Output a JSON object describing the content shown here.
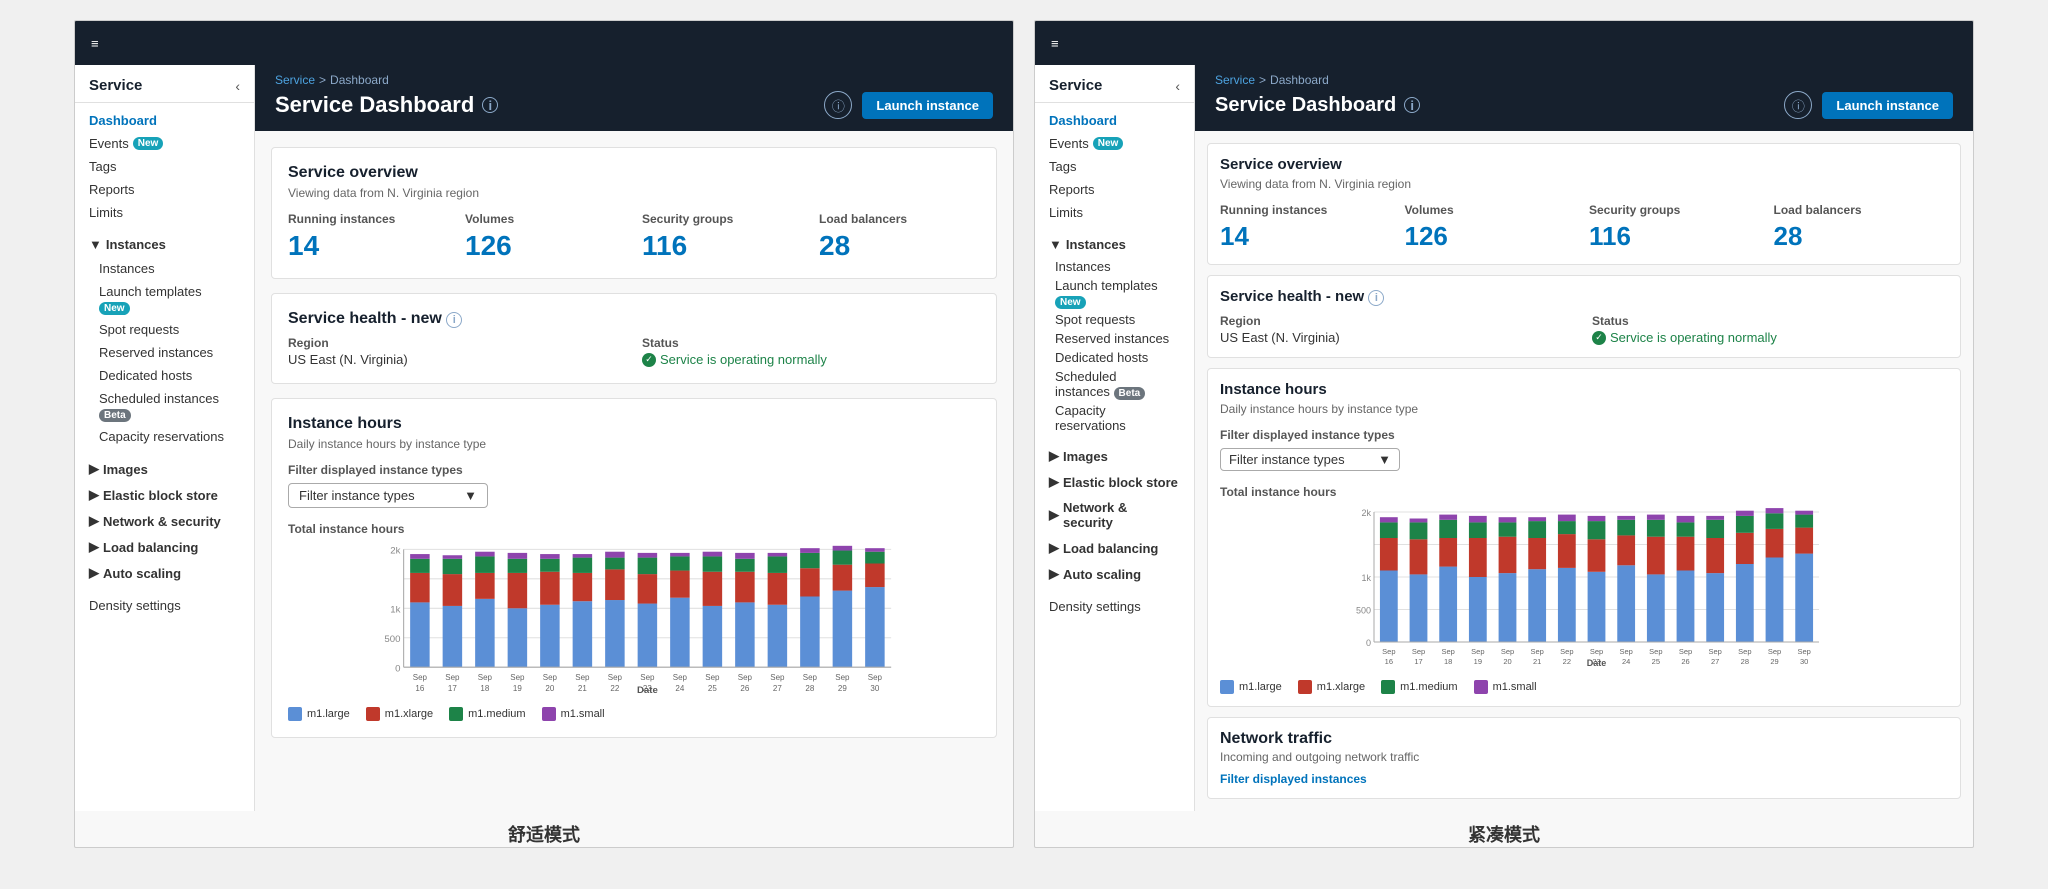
{
  "panels": [
    {
      "id": "comfortable",
      "mode_label": "舒适模式",
      "sidebar": {
        "title": "Service",
        "nav_items": [
          {
            "label": "Dashboard",
            "type": "link",
            "active": true
          },
          {
            "label": "Events",
            "type": "link",
            "badge": "New",
            "badge_type": "new"
          },
          {
            "label": "Tags",
            "type": "link"
          },
          {
            "label": "Reports",
            "type": "link"
          },
          {
            "label": "Limits",
            "type": "link"
          },
          {
            "label": "Instances",
            "type": "section",
            "expanded": true,
            "children": [
              {
                "label": "Instances"
              },
              {
                "label": "Launch templates",
                "badge": "New",
                "badge_type": "new"
              },
              {
                "label": "Spot requests"
              },
              {
                "label": "Reserved instances"
              },
              {
                "label": "Dedicated hosts"
              },
              {
                "label": "Scheduled instances",
                "badge": "Beta",
                "badge_type": "beta"
              },
              {
                "label": "Capacity reservations"
              }
            ]
          },
          {
            "label": "Images",
            "type": "section",
            "expanded": false
          },
          {
            "label": "Elastic block store",
            "type": "section",
            "expanded": false
          },
          {
            "label": "Network & security",
            "type": "section",
            "expanded": false
          },
          {
            "label": "Load balancing",
            "type": "section",
            "expanded": false
          },
          {
            "label": "Auto scaling",
            "type": "section",
            "expanded": false
          },
          {
            "label": "Density settings",
            "type": "link",
            "bottom": true
          }
        ]
      },
      "header": {
        "breadcrumb_service": "Service",
        "breadcrumb_sep": ">",
        "breadcrumb_page": "Dashboard",
        "title": "Service Dashboard",
        "title_suffix": "info",
        "launch_btn": "Launch instance"
      },
      "overview": {
        "title": "Service overview",
        "subtitle": "Viewing data from N. Virginia region",
        "stats": [
          {
            "label": "Running instances",
            "value": "14"
          },
          {
            "label": "Volumes",
            "value": "126"
          },
          {
            "label": "Security groups",
            "value": "116"
          },
          {
            "label": "Load balancers",
            "value": "28"
          }
        ]
      },
      "health": {
        "title": "Service health - new",
        "title_badge": "Info",
        "region_label": "Region",
        "region_value": "US East (N. Virginia)",
        "status_label": "Status",
        "status_value": "Service is operating normally"
      },
      "instance_hours": {
        "title": "Instance hours",
        "subtitle": "Daily instance hours by instance type",
        "filter_label": "Filter displayed instance types",
        "filter_placeholder": "Filter instance types",
        "chart_title": "Total instance hours",
        "y_labels": [
          "2k",
          "1k",
          "500",
          "0"
        ],
        "x_labels": [
          "Sep 16",
          "Sep 17",
          "Sep 18",
          "Sep 19",
          "Sep 20",
          "Sep 21",
          "Sep 22",
          "Sep 23",
          "Sep 24",
          "Sep 25",
          "Sep 26",
          "Sep 27",
          "Sep 28",
          "Sep 29",
          "Sep 30"
        ],
        "x_axis_title": "Date",
        "legend": [
          {
            "label": "m1.large",
            "color": "#5b8fd6"
          },
          {
            "label": "m1.xlarge",
            "color": "#c0392b"
          },
          {
            "label": "m1.medium",
            "color": "#1d8348"
          },
          {
            "label": "m1.small",
            "color": "#8e44ad"
          }
        ]
      }
    },
    {
      "id": "compact",
      "mode_label": "紧凑模式",
      "sidebar": {
        "title": "Service",
        "nav_items": [
          {
            "label": "Dashboard",
            "type": "link",
            "active": true
          },
          {
            "label": "Events",
            "type": "link",
            "badge": "New",
            "badge_type": "new"
          },
          {
            "label": "Tags",
            "type": "link"
          },
          {
            "label": "Reports",
            "type": "link"
          },
          {
            "label": "Limits",
            "type": "link"
          },
          {
            "label": "Instances",
            "type": "section",
            "expanded": true,
            "children": [
              {
                "label": "Instances"
              },
              {
                "label": "Launch templates",
                "badge": "New",
                "badge_type": "new"
              },
              {
                "label": "Spot requests"
              },
              {
                "label": "Reserved instances"
              },
              {
                "label": "Dedicated hosts"
              },
              {
                "label": "Scheduled instances",
                "badge": "Beta",
                "badge_type": "beta"
              },
              {
                "label": "Capacity reservations"
              }
            ]
          },
          {
            "label": "Images",
            "type": "section",
            "expanded": false
          },
          {
            "label": "Elastic block store",
            "type": "section",
            "expanded": false
          },
          {
            "label": "Network & security",
            "type": "section",
            "expanded": false
          },
          {
            "label": "Load balancing",
            "type": "section",
            "expanded": false
          },
          {
            "label": "Auto scaling",
            "type": "section",
            "expanded": false
          },
          {
            "label": "Density settings",
            "type": "link",
            "bottom": true
          }
        ]
      },
      "header": {
        "breadcrumb_service": "Service",
        "breadcrumb_sep": ">",
        "breadcrumb_page": "Dashboard",
        "title": "Service Dashboard",
        "title_suffix": "info",
        "launch_btn": "Launch instance"
      },
      "overview": {
        "title": "Service overview",
        "subtitle": "Viewing data from N. Virginia region",
        "stats": [
          {
            "label": "Running instances",
            "value": "14"
          },
          {
            "label": "Volumes",
            "value": "126"
          },
          {
            "label": "Security groups",
            "value": "116"
          },
          {
            "label": "Load balancers",
            "value": "28"
          }
        ]
      },
      "health": {
        "title": "Service health - new",
        "title_badge": "Info",
        "region_label": "Region",
        "region_value": "US East (N. Virginia)",
        "status_label": "Status",
        "status_value": "Service is operating normally"
      },
      "instance_hours": {
        "title": "Instance hours",
        "subtitle": "Daily instance hours by instance type",
        "filter_label": "Filter displayed instance types",
        "filter_placeholder": "Filter instance types",
        "chart_title": "Total instance hours",
        "y_labels": [
          "2k",
          "1k",
          "500",
          "0"
        ],
        "x_labels": [
          "Sep 16",
          "Sep 17",
          "Sep 18",
          "Sep 19",
          "Sep 20",
          "Sep 21",
          "Sep 22",
          "Sep 23",
          "Sep 24",
          "Sep 25",
          "Sep 26",
          "Sep 27",
          "Sep 28",
          "Sep 29",
          "Sep 30"
        ],
        "x_axis_title": "Date",
        "legend": [
          {
            "label": "m1.large",
            "color": "#5b8fd6"
          },
          {
            "label": "m1.xlarge",
            "color": "#c0392b"
          },
          {
            "label": "m1.medium",
            "color": "#1d8348"
          },
          {
            "label": "m1.small",
            "color": "#8e44ad"
          }
        ]
      },
      "network": {
        "title": "Network traffic",
        "subtitle": "Incoming and outgoing network traffic",
        "filter_label": "Filter displayed instances"
      }
    }
  ],
  "chart_data": {
    "bars": [
      {
        "large": 0.55,
        "xlarge": 0.25,
        "medium": 0.12,
        "small": 0.04
      },
      {
        "large": 0.52,
        "xlarge": 0.27,
        "medium": 0.13,
        "small": 0.03
      },
      {
        "large": 0.58,
        "xlarge": 0.22,
        "medium": 0.14,
        "small": 0.04
      },
      {
        "large": 0.5,
        "xlarge": 0.3,
        "medium": 0.12,
        "small": 0.05
      },
      {
        "large": 0.53,
        "xlarge": 0.28,
        "medium": 0.11,
        "small": 0.04
      },
      {
        "large": 0.56,
        "xlarge": 0.24,
        "medium": 0.13,
        "small": 0.03
      },
      {
        "large": 0.57,
        "xlarge": 0.26,
        "medium": 0.1,
        "small": 0.05
      },
      {
        "large": 0.54,
        "xlarge": 0.25,
        "medium": 0.14,
        "small": 0.04
      },
      {
        "large": 0.59,
        "xlarge": 0.23,
        "medium": 0.12,
        "small": 0.03
      },
      {
        "large": 0.52,
        "xlarge": 0.29,
        "medium": 0.13,
        "small": 0.04
      },
      {
        "large": 0.55,
        "xlarge": 0.26,
        "medium": 0.11,
        "small": 0.05
      },
      {
        "large": 0.53,
        "xlarge": 0.27,
        "medium": 0.14,
        "small": 0.03
      },
      {
        "large": 0.6,
        "xlarge": 0.24,
        "medium": 0.13,
        "small": 0.04
      },
      {
        "large": 0.65,
        "xlarge": 0.22,
        "medium": 0.12,
        "small": 0.04
      },
      {
        "large": 0.68,
        "xlarge": 0.2,
        "medium": 0.1,
        "small": 0.03
      }
    ]
  }
}
